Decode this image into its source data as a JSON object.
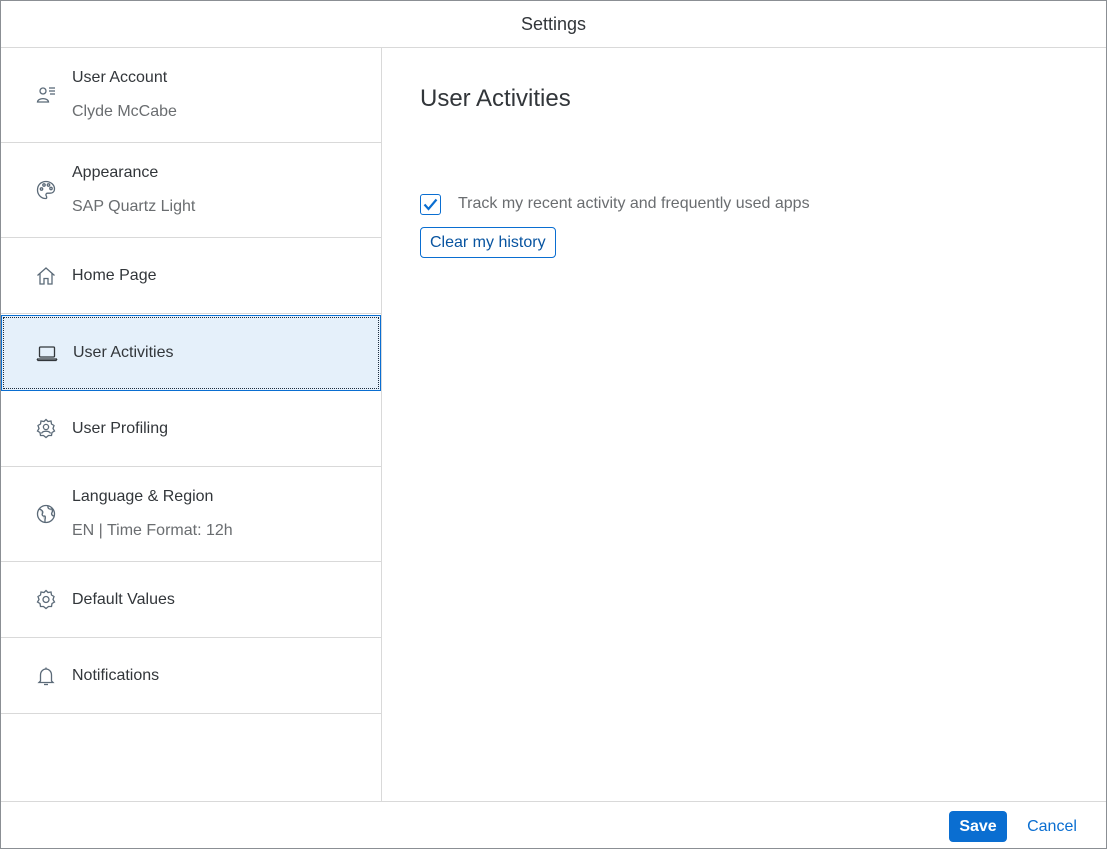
{
  "dialog": {
    "title": "Settings"
  },
  "sidebar": {
    "items": [
      {
        "title": "User Account",
        "desc": "Clyde McCabe",
        "icon": "user-account-icon"
      },
      {
        "title": "Appearance",
        "desc": "SAP Quartz Light",
        "icon": "palette-icon"
      },
      {
        "title": "Home Page",
        "icon": "home-icon"
      },
      {
        "title": "User Activities",
        "icon": "laptop-icon",
        "selected": true
      },
      {
        "title": "User Profiling",
        "icon": "user-settings-icon"
      },
      {
        "title": "Language & Region",
        "desc": "EN | Time Format: 12h",
        "icon": "globe-icon"
      },
      {
        "title": "Default Values",
        "icon": "gear-icon"
      },
      {
        "title": "Notifications",
        "icon": "bell-icon"
      }
    ]
  },
  "content": {
    "title": "User Activities",
    "track_label": "Track my recent activity and frequently used apps",
    "track_checked": true,
    "clear_button": "Clear my history"
  },
  "footer": {
    "save_label": "Save",
    "cancel_label": "Cancel"
  },
  "colors": {
    "accent": "#0a6ed1",
    "selected_bg": "#e5f0fa",
    "text": "#32363a",
    "secondary_text": "#6a6d70"
  }
}
